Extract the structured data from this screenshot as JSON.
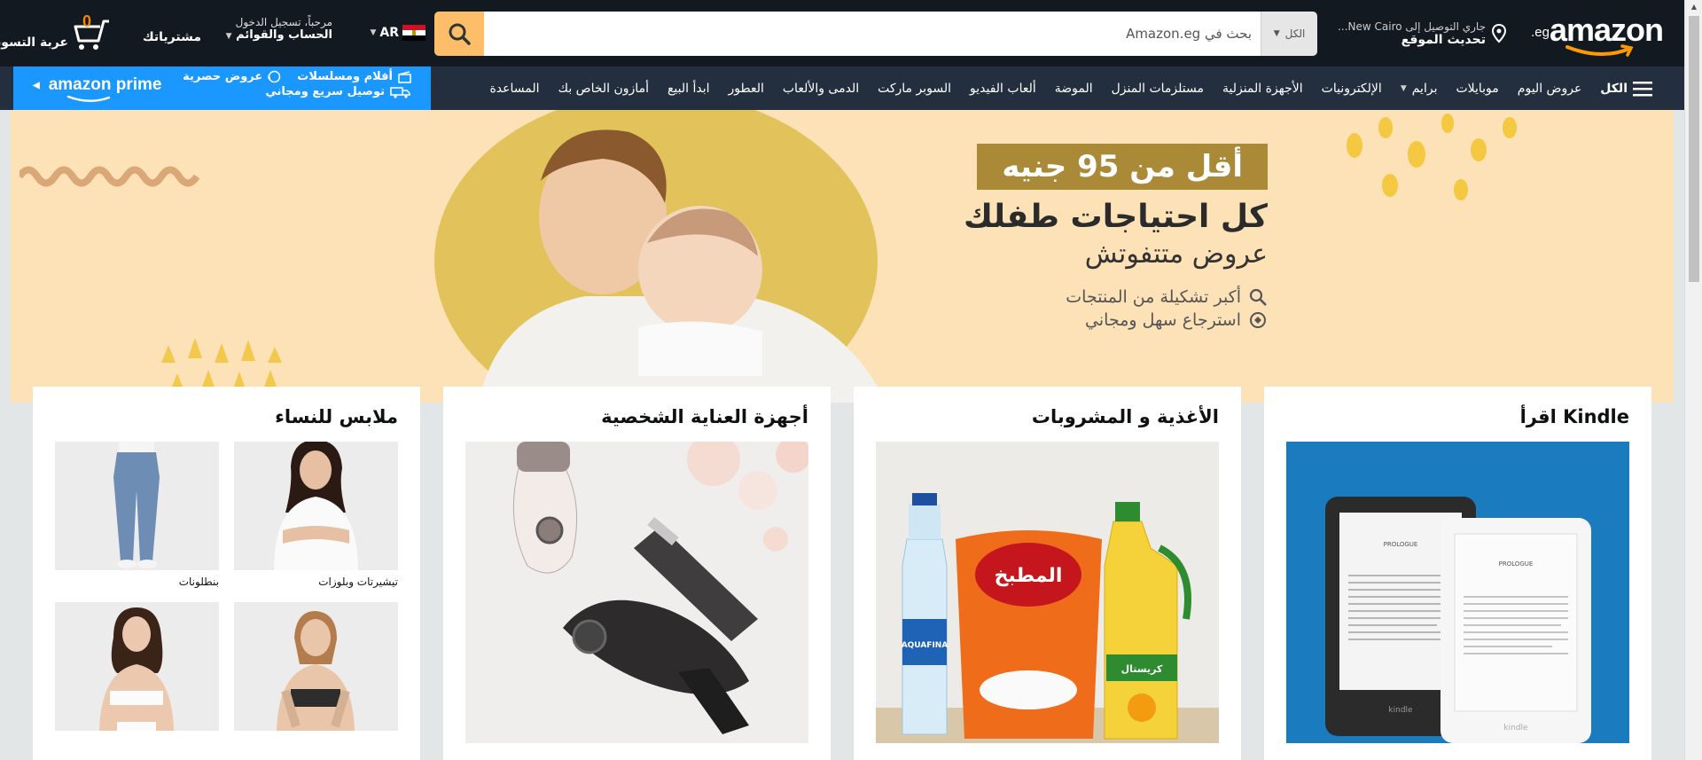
{
  "header": {
    "logo_text": "amazon",
    "logo_tld": ".eg",
    "deliver_line1": "جاري التوصيل إلى New Cairo...",
    "deliver_line2": "تحديث الموقع",
    "search_category": "الكل",
    "search_placeholder": "بحث في Amazon.eg",
    "language": "AR",
    "account_line1": "مرحباً، تسجيل الدخول",
    "account_line2": "الحساب والقوائم",
    "orders": "مشترياتك",
    "cart_count": "0",
    "cart_label": "عربة التسوق"
  },
  "nav": {
    "items": [
      {
        "label": "الكل"
      },
      {
        "label": "عروض اليوم"
      },
      {
        "label": "موبايلات"
      },
      {
        "label": "برايم"
      },
      {
        "label": "الإلكترونيات"
      },
      {
        "label": "الأجهزة المنزلية"
      },
      {
        "label": "مستلزمات المنزل"
      },
      {
        "label": "الموضة"
      },
      {
        "label": "ألعاب الفيديو"
      },
      {
        "label": "السوبر ماركت"
      },
      {
        "label": "الدمى والألعاب"
      },
      {
        "label": "العطور"
      },
      {
        "label": "ابدأ البيع"
      },
      {
        "label": "أمازون الخاص بك"
      },
      {
        "label": "المساعدة"
      }
    ],
    "prime_logo": "amazon prime",
    "prime_links": [
      {
        "label": "أفلام ومسلسلات"
      },
      {
        "label": "عروض حصرية"
      },
      {
        "label": "توصيل سريع ومجاني"
      }
    ]
  },
  "hero": {
    "badge": "أقل من 95 جنيه",
    "title": "كل احتياجات طفلك",
    "subtitle": "عروض متتفوتش",
    "features": [
      {
        "label": "أكبر تشكيلة من المنتجات"
      },
      {
        "label": "استرجاع سهل ومجاني"
      }
    ]
  },
  "cards": [
    {
      "title": "Kindle اقرأ"
    },
    {
      "title": "الأغذية و المشروبات"
    },
    {
      "title": "أجهزة العناية الشخصية"
    },
    {
      "title": "ملابس للنساء",
      "items": [
        {
          "label": "تيشيرتات وبلوزات"
        },
        {
          "label": "بنطلونات"
        },
        {
          "label": ""
        },
        {
          "label": ""
        }
      ]
    }
  ],
  "product_text": {
    "aquafina": "AQUAFINA",
    "kindle_prologue": "PROLOGUE",
    "kindle_brand": "kindle",
    "rice_brand": "المطبخ",
    "oil_brand": "كريستال"
  },
  "colors": {
    "header_bg": "#131921",
    "nav_bg": "#232f3e",
    "search_button": "#febd69",
    "prime_bg": "#1a98ff",
    "hero_bg": "#fde1b7",
    "hero_badge": "#aa8a37",
    "cart_count": "#f08804"
  }
}
